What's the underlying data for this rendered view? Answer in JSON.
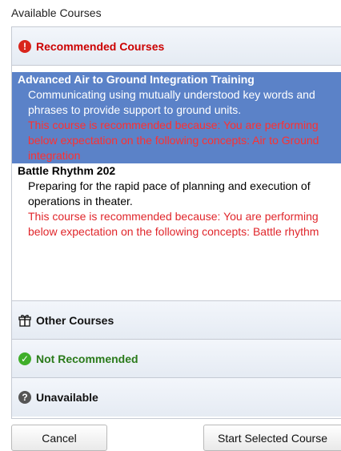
{
  "dialog": {
    "title": "Available Courses"
  },
  "sections": {
    "recommended": {
      "label": "Recommended Courses",
      "icon": "alert-icon",
      "color": "#cc0000",
      "courses": [
        {
          "title": "Advanced Air to Ground Integration Training",
          "description": "Communicating using mutually understood key words and phrases to provide support to ground units.",
          "reason": "This course is recommended because: You are performing below expectation on the following concepts: Air to Ground integration",
          "selected": true
        },
        {
          "title": "Battle Rhythm 202",
          "description": "Preparing for the rapid pace of planning and execution of operations in theater.",
          "reason": "This course is recommended because: You are performing below expectation on the following concepts: Battle rhythm",
          "selected": false
        }
      ]
    },
    "other": {
      "label": "Other Courses",
      "icon": "gift-icon"
    },
    "not_recommended": {
      "label": "Not Recommended",
      "icon": "check-icon",
      "color": "#2a7a1a"
    },
    "unavailable": {
      "label": "Unavailable",
      "icon": "question-icon"
    }
  },
  "buttons": {
    "cancel": "Cancel",
    "start": "Start Selected Course"
  },
  "colors": {
    "selection": "#5b82c8",
    "reason_text": "#e0262b",
    "alert_red": "#d9251c",
    "check_green": "#3fae2a"
  }
}
